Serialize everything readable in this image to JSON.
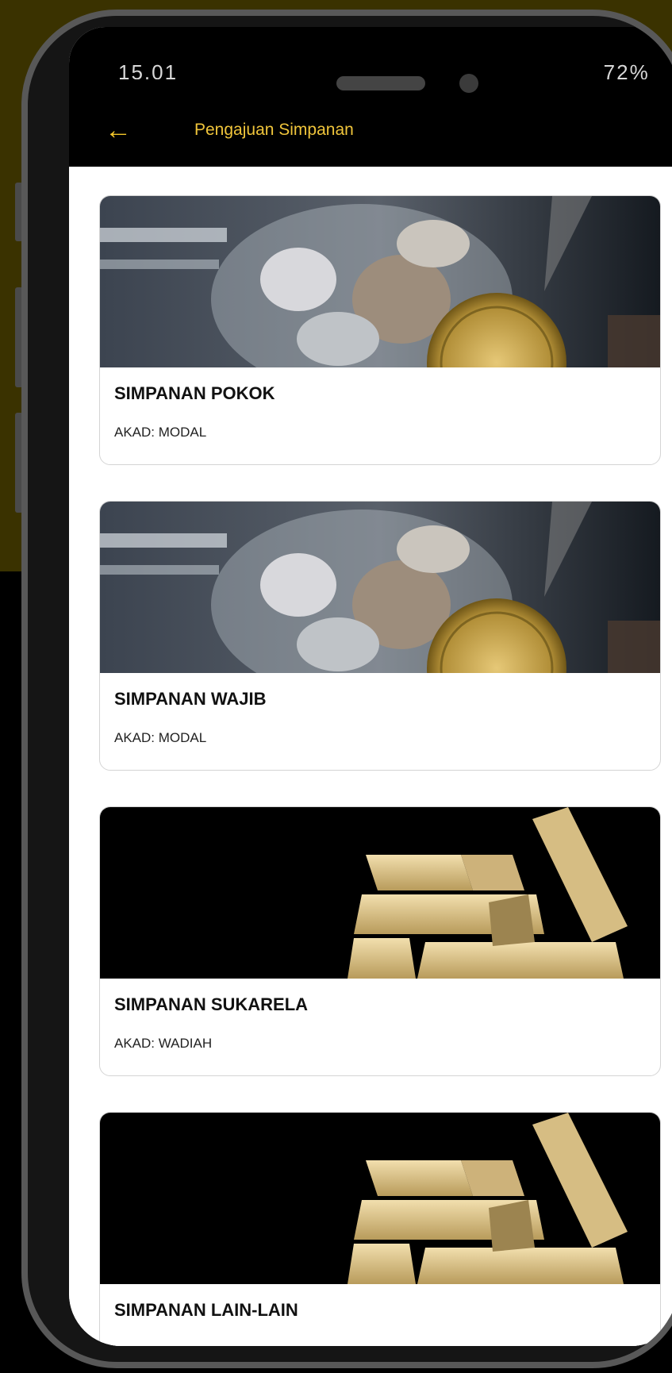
{
  "status_bar": {
    "time": "15.01",
    "battery": "72%"
  },
  "header": {
    "title": "Pengajuan Simpanan"
  },
  "cards": [
    {
      "title": "SIMPANAN POKOK",
      "akad": "AKAD: MODAL",
      "image": "coin-jar"
    },
    {
      "title": "SIMPANAN WAJIB",
      "akad": "AKAD: MODAL",
      "image": "coin-jar"
    },
    {
      "title": "SIMPANAN SUKARELA",
      "akad": "AKAD: WADIAH",
      "image": "gold-bars"
    },
    {
      "title": "SIMPANAN LAIN-LAIN",
      "akad": "",
      "image": "gold-bars"
    }
  ],
  "colors": {
    "accent": "#f0c53b",
    "frame_background": "#3a3200",
    "appbar": "#000000"
  }
}
